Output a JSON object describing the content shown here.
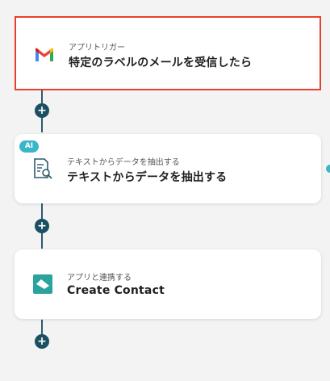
{
  "steps": [
    {
      "subtitle": "アプリトリガー",
      "title": "特定のラベルのメールを受信したら",
      "icon": "gmail-icon"
    },
    {
      "badge": "AI",
      "subtitle": "テキストからデータを抽出する",
      "title": "テキストからデータを抽出する",
      "icon": "document-search-icon"
    },
    {
      "subtitle": "アプリと連携する",
      "title": "Create Contact",
      "icon": "app-logo-icon"
    }
  ],
  "add_button_label": "+",
  "colors": {
    "selected_border": "#e8412a",
    "connector": "#2b5a6e",
    "add_button": "#1d4f63",
    "ai_badge": "#39b6c9",
    "app_logo": "#2aa39c"
  }
}
